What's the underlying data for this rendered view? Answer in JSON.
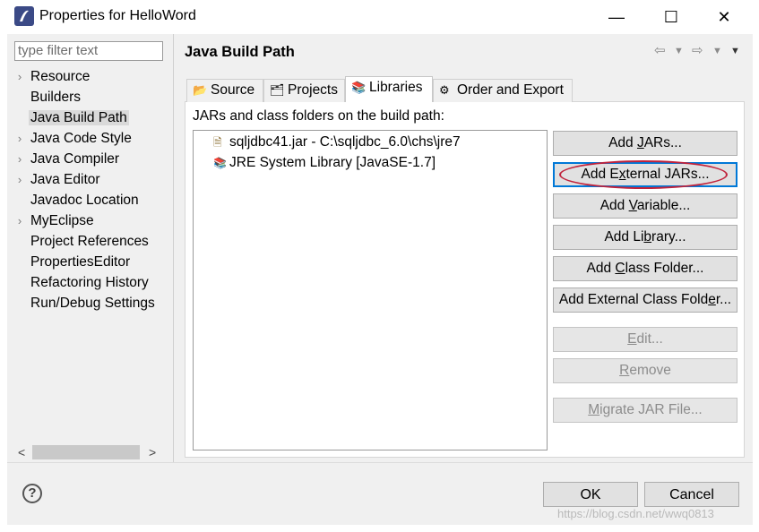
{
  "window": {
    "title": "Properties for HelloWord",
    "minimize_glyph": "—",
    "maximize_glyph": "☐",
    "close_glyph": "✕"
  },
  "sidebar": {
    "filter_placeholder": "type filter text",
    "items": [
      {
        "label": "Resource",
        "expandable": true
      },
      {
        "label": "Builders",
        "expandable": false
      },
      {
        "label": "Java Build Path",
        "expandable": false,
        "selected": true
      },
      {
        "label": "Java Code Style",
        "expandable": true
      },
      {
        "label": "Java Compiler",
        "expandable": true
      },
      {
        "label": "Java Editor",
        "expandable": true
      },
      {
        "label": "Javadoc Location",
        "expandable": false
      },
      {
        "label": "MyEclipse",
        "expandable": true
      },
      {
        "label": "Project References",
        "expandable": false
      },
      {
        "label": "PropertiesEditor",
        "expandable": false
      },
      {
        "label": "Refactoring History",
        "expandable": false
      },
      {
        "label": "Run/Debug Settings",
        "expandable": false
      }
    ]
  },
  "page": {
    "title": "Java Build Path",
    "tabs": [
      {
        "label": "Source",
        "icon": "source-folder-icon"
      },
      {
        "label": "Projects",
        "icon": "projects-icon"
      },
      {
        "label": "Libraries",
        "icon": "libraries-icon",
        "active": true
      },
      {
        "label": "Order and Export",
        "icon": "order-export-icon"
      }
    ],
    "list_label": "JARs and class folders on the build path:",
    "libraries": [
      {
        "label": "sqljdbc41.jar - C:\\sqljdbc_6.0\\chs\\jre7",
        "icon": "jar-file-icon"
      },
      {
        "label": "JRE System Library [JavaSE-1.7]",
        "icon": "library-icon"
      }
    ],
    "buttons": {
      "add_jars": {
        "pre": "Add ",
        "u": "J",
        "post": "ARs..."
      },
      "add_external_jars": {
        "pre": "Add E",
        "u": "x",
        "post": "ternal JARs..."
      },
      "add_variable": {
        "pre": "Add ",
        "u": "V",
        "post": "ariable..."
      },
      "add_library": {
        "pre": "Add Li",
        "u": "b",
        "post": "rary..."
      },
      "add_class_folder": {
        "pre": "Add ",
        "u": "C",
        "post": "lass Folder..."
      },
      "add_external_class_folder": {
        "pre": "Add External Class Fold",
        "u": "e",
        "post": "r..."
      },
      "edit": {
        "pre": "",
        "u": "E",
        "post": "dit..."
      },
      "remove": {
        "pre": "",
        "u": "R",
        "post": "emove"
      },
      "migrate": {
        "pre": "",
        "u": "M",
        "post": "igrate JAR File..."
      }
    }
  },
  "dialog": {
    "ok_label": "OK",
    "cancel_label": "Cancel",
    "help_glyph": "?"
  },
  "watermark": "https://blog.csdn.net/wwq0813",
  "colors": {
    "highlight_ellipse": "#c0223b",
    "focus_border": "#0078d7"
  }
}
